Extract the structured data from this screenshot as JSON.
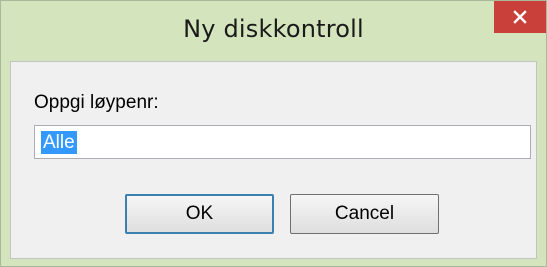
{
  "dialog": {
    "title": "Ny diskkontroll",
    "close_icon": "close-icon",
    "prompt_label": "Oppgi løypenr:",
    "input_value": "Alle",
    "ok_label": "OK",
    "cancel_label": "Cancel"
  },
  "colors": {
    "titlebar": "#d4e4bc",
    "close_button": "#c9403a",
    "selection": "#3399ff",
    "client_background": "#f0f0f0"
  }
}
